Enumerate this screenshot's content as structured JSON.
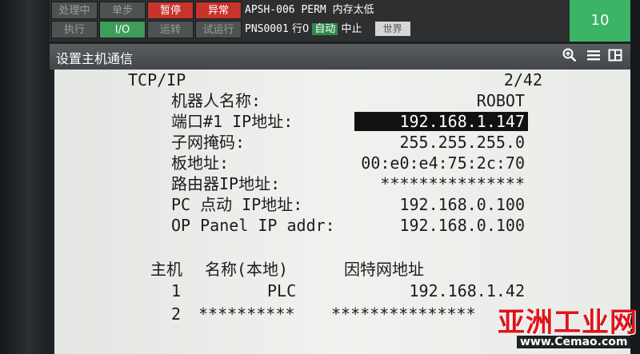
{
  "status": {
    "buttons": [
      {
        "label": "处理中"
      },
      {
        "label": "单步"
      },
      {
        "label": "暂停"
      },
      {
        "label": "异常"
      },
      {
        "label": "执行"
      },
      {
        "label": "I/O"
      },
      {
        "label": "运转"
      },
      {
        "label": "试运行"
      }
    ],
    "alarm": "APSH-006 PERM 内存太低",
    "program": "PNS0001",
    "line": "行0",
    "mode": "自动",
    "state": "中止",
    "coord": "世界",
    "override": "10"
  },
  "header": {
    "title": "设置主机通信",
    "icons": [
      "zoom-icon",
      "menu-icon",
      "split-view-icon"
    ]
  },
  "screen": {
    "protocol": "TCP/IP",
    "page": "2/42",
    "fields": [
      {
        "label": "机器人名称:",
        "value": "ROBOT"
      },
      {
        "label": "端口#1 IP地址:",
        "value": "192.168.1.147"
      },
      {
        "label": "子网掩码:",
        "value": "255.255.255.0"
      },
      {
        "label": "板地址:",
        "value": "00:e0:e4:75:2c:70"
      },
      {
        "label": "路由器IP地址:",
        "value": "***************"
      },
      {
        "label": "PC 点动 IP地址:",
        "value": "192.168.0.100"
      },
      {
        "label": "OP Panel IP addr:",
        "value": "192.168.0.100"
      }
    ],
    "host_table": {
      "headers": [
        "主机",
        "名称(本地)",
        "因特网地址"
      ],
      "rows": [
        {
          "index": "1",
          "name": "PLC",
          "address": "192.168.1.42"
        },
        {
          "index": "2",
          "name": "**********",
          "address": "***************"
        }
      ]
    }
  },
  "watermark": {
    "main": "亚洲工业网",
    "sub": "www.Cemao.com"
  }
}
